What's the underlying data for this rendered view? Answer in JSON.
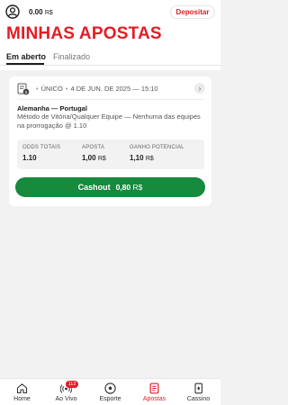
{
  "header": {
    "balance_amount": "0.00",
    "balance_currency": "R$",
    "deposit_label": "Depositar",
    "title": "MINHAS APOSTAS"
  },
  "tabs": [
    {
      "label": "Em aberto",
      "active": true
    },
    {
      "label": "Finalizado",
      "active": false
    }
  ],
  "bet": {
    "type": "ÚNICO",
    "date": "4 DE JUN. DE 2025 — 15:10",
    "count_badge": "1",
    "match": "Alemanha — Portugal",
    "market": "Método de Vitória/Qualquer Equipe — Nenhuma das equipes na prorrogação @ 1.10",
    "stats": {
      "odds_label": "ODDS TOTAIS",
      "odds_value": "1.10",
      "stake_label": "APOSTA",
      "stake_value": "1,00",
      "stake_currency": "R$",
      "potential_label": "GANHO POTENCIAL",
      "potential_value": "1,10",
      "potential_currency": "R$"
    },
    "cashout_label": "Cashout",
    "cashout_amount": "0,80",
    "cashout_currency": "R$"
  },
  "nav": [
    {
      "label": "Home",
      "icon": "home-icon",
      "active": false
    },
    {
      "label": "Ao Vivo",
      "icon": "live-icon",
      "badge": "112",
      "active": false
    },
    {
      "label": "Esporte",
      "icon": "soccer-ball-icon",
      "active": false
    },
    {
      "label": "Apostas",
      "icon": "bets-slip-icon",
      "active": true
    },
    {
      "label": "Cassino",
      "icon": "cards-icon",
      "active": false
    }
  ],
  "colors": {
    "brand_red": "#e31c25",
    "cashout_green": "#168a3d",
    "background": "#f2f2f2"
  }
}
